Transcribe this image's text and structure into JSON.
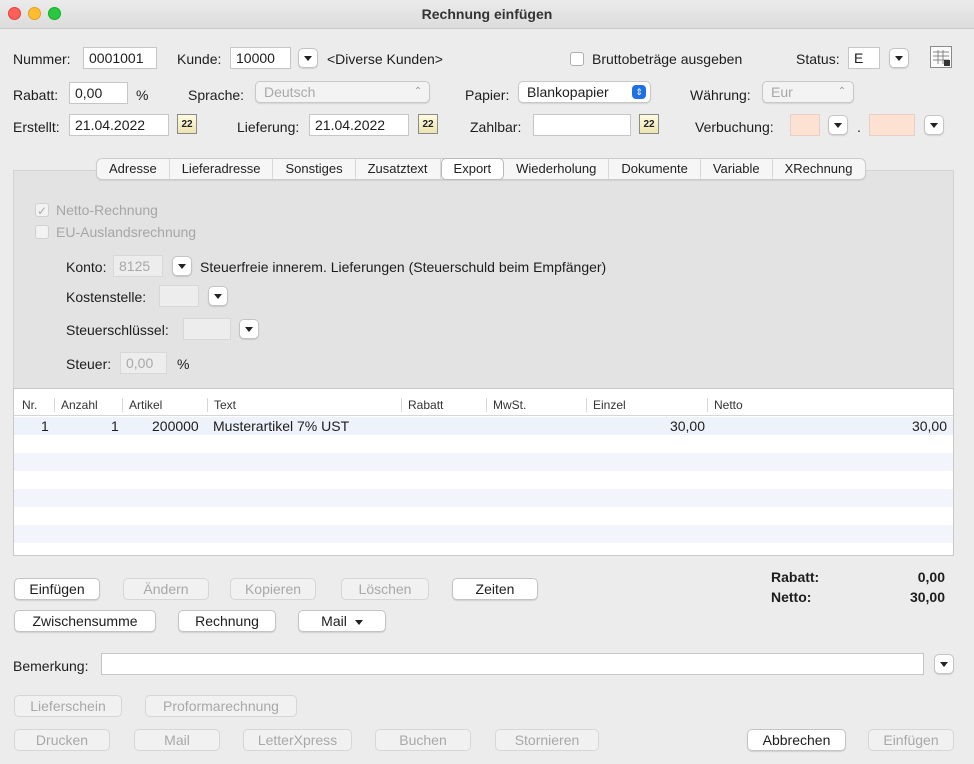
{
  "window": {
    "title": "Rechnung einfügen"
  },
  "header": {
    "nummer_label": "Nummer:",
    "nummer_value": "0001001",
    "kunde_label": "Kunde:",
    "kunde_value": "10000",
    "kunde_name": "<Diverse Kunden>",
    "brutto_label": "Bruttobeträge ausgeben",
    "status_label": "Status:",
    "status_value": "E",
    "rabatt_label": "Rabatt:",
    "rabatt_value": "0,00",
    "rabatt_unit": "%",
    "sprache_label": "Sprache:",
    "sprache_value": "Deutsch",
    "papier_label": "Papier:",
    "papier_value": "Blankopapier",
    "waehrung_label": "Währung:",
    "waehrung_value": "Eur",
    "erstellt_label": "Erstellt:",
    "erstellt_value": "21.04.2022",
    "lieferung_label": "Lieferung:",
    "lieferung_value": "21.04.2022",
    "zahlbar_label": "Zahlbar:",
    "zahlbar_value": "",
    "verbuchung_label": "Verbuchung:",
    "verbuchung_sep": ".",
    "calendar_day": "22"
  },
  "tabs": [
    "Adresse",
    "Lieferadresse",
    "Sonstiges",
    "Zusatztext",
    "Export",
    "Wiederholung",
    "Dokumente",
    "Variable",
    "XRechnung"
  ],
  "selected_tab": "Export",
  "export": {
    "netto_label": "Netto-Rechnung",
    "eu_label": "EU-Auslandsrechnung",
    "konto_label": "Konto:",
    "konto_value": "8125",
    "konto_desc": "Steuerfreie innerem. Lieferungen (Steuerschuld beim Empfänger)",
    "kostenstelle_label": "Kostenstelle:",
    "steuerschluessel_label": "Steuerschlüssel:",
    "steuer_label": "Steuer:",
    "steuer_value": "0,00",
    "steuer_unit": "%",
    "checkmark": "✓"
  },
  "table": {
    "columns": [
      "Nr.",
      "Anzahl",
      "Artikel",
      "Text",
      "Rabatt",
      "MwSt.",
      "Einzel",
      "Netto"
    ],
    "rows": [
      {
        "nr": "1",
        "anzahl": "1",
        "artikel": "200000",
        "text": "Musterartikel 7% UST",
        "rabatt": "",
        "mwst": "",
        "einzel": "30,00",
        "netto": "30,00"
      }
    ]
  },
  "actions": {
    "einfuegen": "Einfügen",
    "aendern": "Ändern",
    "kopieren": "Kopieren",
    "loeschen": "Löschen",
    "zeiten": "Zeiten",
    "zwischensumme": "Zwischensumme",
    "rechnung": "Rechnung",
    "mail": "Mail"
  },
  "totals": {
    "rabatt_label": "Rabatt:",
    "rabatt_value": "0,00",
    "netto_label": "Netto:",
    "netto_value": "30,00"
  },
  "bemerkung": {
    "label": "Bemerkung:",
    "value": ""
  },
  "footer": {
    "lieferschein": "Lieferschein",
    "proforma": "Proformarechnung",
    "drucken": "Drucken",
    "mail": "Mail",
    "letterxpress": "LetterXpress",
    "buchen": "Buchen",
    "stornieren": "Stornieren",
    "abbrechen": "Abbrechen",
    "einfuegen": "Einfügen"
  },
  "colors": {
    "accent": "#1f6fe5",
    "salmon_field": "#fde1d3"
  }
}
